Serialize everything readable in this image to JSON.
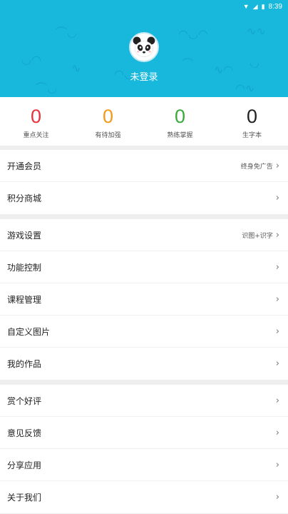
{
  "status_bar": {
    "time": "8:39",
    "icons": [
      "wifi-icon",
      "signal-icon",
      "battery-icon"
    ]
  },
  "profile": {
    "login_label": "未登录",
    "avatar": "panda-avatar-icon"
  },
  "stats": [
    {
      "value": "0",
      "label": "重点关注",
      "color": "#e8323c"
    },
    {
      "value": "0",
      "label": "有待加强",
      "color": "#f39a1e"
    },
    {
      "value": "0",
      "label": "熟练掌握",
      "color": "#3aab3a"
    },
    {
      "value": "0",
      "label": "生字本",
      "color": "#222222"
    }
  ],
  "menu": {
    "group1": [
      {
        "label": "开通会员",
        "extra": "终身免广告"
      },
      {
        "label": "积分商城",
        "extra": ""
      }
    ],
    "group2": [
      {
        "label": "游戏设置",
        "extra": "识图+识字"
      },
      {
        "label": "功能控制",
        "extra": ""
      },
      {
        "label": "课程管理",
        "extra": ""
      },
      {
        "label": "自定义图片",
        "extra": ""
      },
      {
        "label": "我的作品",
        "extra": ""
      }
    ],
    "group3": [
      {
        "label": "赏个好评",
        "extra": ""
      },
      {
        "label": "意见反馈",
        "extra": ""
      },
      {
        "label": "分享应用",
        "extra": ""
      },
      {
        "label": "关于我们",
        "extra": ""
      }
    ]
  },
  "chevron": "›",
  "colors": {
    "header": "#17b8dc",
    "background": "#eeeeee"
  }
}
